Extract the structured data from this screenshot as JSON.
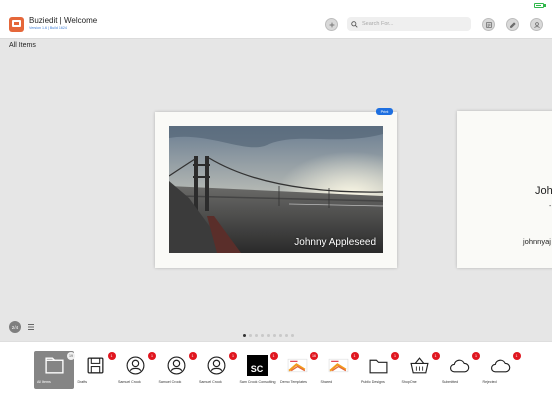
{
  "header": {
    "title": "Buziedit | Welcome",
    "version": "Version 1.6 | Build 1624",
    "search_placeholder": "Search For..."
  },
  "section_title": "All Items",
  "cards": {
    "main_name": "Johnny Appleseed",
    "badge": "Print",
    "next_name": "Joh",
    "next_dash": "-",
    "next_email": "johnnyaj"
  },
  "view_toggle_label": "2/4",
  "pager": {
    "pages": 9,
    "current": 0
  },
  "dock": [
    {
      "label": "All Items",
      "badge": "19",
      "icon": "folder-icon"
    },
    {
      "label": "Drafts",
      "badge": "1",
      "icon": "save-icon"
    },
    {
      "label": "Samuel Crook",
      "badge": "1",
      "icon": "person-icon"
    },
    {
      "label": "Samuel Crook",
      "badge": "1",
      "icon": "person-icon"
    },
    {
      "label": "Samuel Crook",
      "badge": "1",
      "icon": "person-icon"
    },
    {
      "label": "Sam Crook Consulting",
      "badge": "1",
      "icon": "sc-logo-icon",
      "logo_text": "SC"
    },
    {
      "label": "Demo Templates",
      "badge": "16",
      "icon": "card-thumbnail-icon"
    },
    {
      "label": "Shared",
      "badge": "1",
      "icon": "card-thumbnail-icon"
    },
    {
      "label": "Public Designs",
      "badge": "1",
      "icon": "folder-outline-icon"
    },
    {
      "label": "ShopOne",
      "badge": "1",
      "icon": "basket-icon"
    },
    {
      "label": "Submitted",
      "badge": "1",
      "icon": "cloud-icon"
    },
    {
      "label": "Rejected",
      "badge": "1",
      "icon": "cloud-icon"
    }
  ],
  "colors": {
    "accent": "#1e6fe0",
    "badge": "#e0161f",
    "logo": "#e5673a",
    "battery": "#2fb84a"
  }
}
